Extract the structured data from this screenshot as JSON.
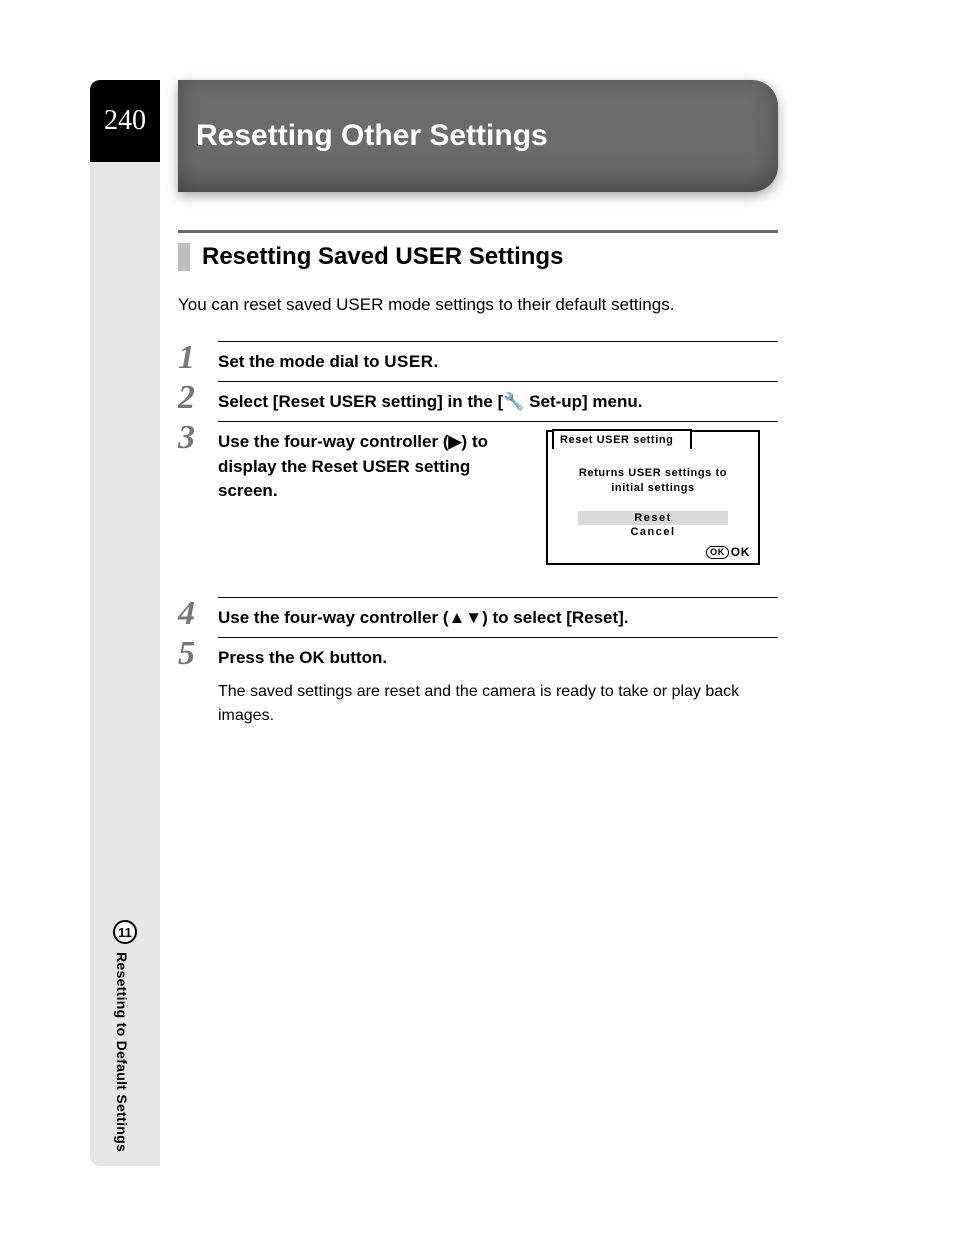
{
  "page_number": "240",
  "title": "Resetting Other Settings",
  "section_heading": "Resetting Saved USER Settings",
  "intro": "You can reset saved USER mode settings to their default settings.",
  "steps": {
    "s1": {
      "num": "1",
      "head_pre": "Set the mode dial to ",
      "head_mode": "USER",
      "head_post": "."
    },
    "s2": {
      "num": "2",
      "head": "Select [Reset USER setting] in the [🔧 Set-up] menu."
    },
    "s3": {
      "num": "3",
      "head": "Use the four-way controller (▶) to display the Reset USER setting screen.",
      "lcd": {
        "tab": "Reset USER setting",
        "msg_l1": "Returns USER settings to",
        "msg_l2": "initial settings",
        "opt_reset": "Reset",
        "opt_cancel": "Cancel",
        "foot_ok_badge": "OK",
        "foot_ok": "OK"
      }
    },
    "s4": {
      "num": "4",
      "head": "Use the four-way controller (▲▼) to select [Reset]."
    },
    "s5": {
      "num": "5",
      "head_pre": "Press the ",
      "head_ok": "OK",
      "head_post": " button.",
      "desc": "The saved settings are reset and the camera is ready to take or play back images."
    }
  },
  "side": {
    "chapter_num": "11",
    "label": "Resetting to Default Settings"
  }
}
